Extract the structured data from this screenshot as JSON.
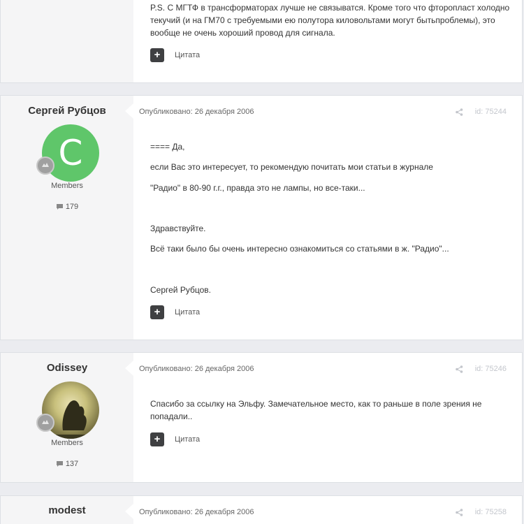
{
  "colors": {
    "page_bg": "#ebecf0",
    "aside_bg": "#f5f5f6",
    "avatar_green": "#5fc66a",
    "button_dark": "#3f4042",
    "meta_light": "#c3c6cc"
  },
  "post_top": {
    "lines": [
      "P.S. С МГТФ в трансформаторах лучше не связыватся. Кроме того что фторопласт холодно",
      "текучий (и на ГМ70 с требуемыми ею полутора киловольтами могут бытьпроблемы), это",
      "вообще не очень хороший провод для сигнала."
    ],
    "quote_label": "Цитата",
    "plus_icon": "plus-icon"
  },
  "post_1": {
    "author": "Сергей Рубцов",
    "avatar_letter": "С",
    "group": "Members",
    "post_count": "179",
    "date": "Опубликовано: 26 декабря 2006",
    "post_id": "id: 75244",
    "paragraphs": [
      "==== Да,",
      "если Вас это интересует, то рекомендую почитать мои статьи в журнале",
      "\"Радио\" в 80-90 г.г., правда это не лампы, но все-таки...",
      "Здравствуйте.",
      "Всё таки было бы очень интересно ознакомиться со статьями в ж. \"Радио\"...",
      "Сергей Рубцов."
    ],
    "quote_label": "Цитата"
  },
  "post_2": {
    "author": "Odissey",
    "group": "Members",
    "post_count": "137",
    "date": "Опубликовано: 26 декабря 2006",
    "post_id": "id: 75246",
    "lines": [
      "Спасибо за ссылку на Эльфу. Замечательное место, как то раньше в поле зрения не",
      "попадали.."
    ],
    "quote_label": "Цитата"
  },
  "post_3": {
    "author": "modest",
    "date": "Опубликовано: 26 декабря 2006",
    "post_id": "id: 75258"
  }
}
